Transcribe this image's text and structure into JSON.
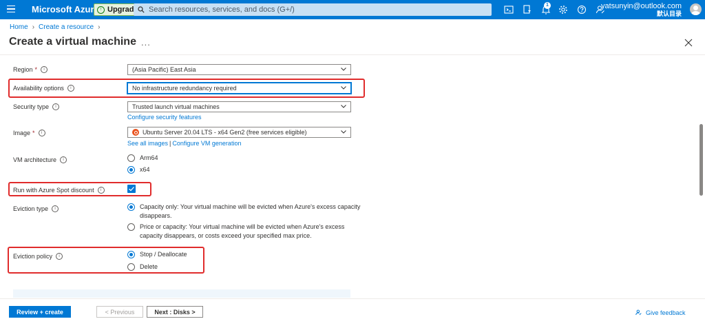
{
  "topbar": {
    "brand": "Microsoft Azure",
    "upgrade_label": "Upgrade",
    "search_placeholder": "Search resources, services, and docs (G+/)",
    "notification_count": "1",
    "account_email": "yatsunyin@outlook.com",
    "account_directory": "默认目录"
  },
  "breadcrumb": {
    "home": "Home",
    "create_resource": "Create a resource"
  },
  "page": {
    "title": "Create a virtual machine",
    "more": "..."
  },
  "form": {
    "region": {
      "label": "Region",
      "value": "(Asia Pacific) East Asia"
    },
    "availability": {
      "label": "Availability options",
      "value": "No infrastructure redundancy required"
    },
    "security_type": {
      "label": "Security type",
      "value": "Trusted launch virtual machines",
      "link": "Configure security features"
    },
    "image": {
      "label": "Image",
      "value": "Ubuntu Server 20.04 LTS - x64 Gen2 (free services eligible)",
      "link_all": "See all images",
      "link_sep": "|",
      "link_gen": "Configure VM generation"
    },
    "vm_architecture": {
      "label": "VM architecture",
      "options": [
        "Arm64",
        "x64"
      ],
      "selected": "x64"
    },
    "spot": {
      "label": "Run with Azure Spot discount",
      "checked": true
    },
    "eviction_type": {
      "label": "Eviction type",
      "options": [
        {
          "line1": "Capacity only: Your virtual machine will be evicted when Azure's excess capacity",
          "line2": "disappears."
        },
        {
          "line1": "Price or capacity: Your virtual machine will be evicted when Azure's excess",
          "line2": "capacity disappears, or costs exceed your specified max price."
        }
      ],
      "selected": 0
    },
    "eviction_policy": {
      "label": "Eviction policy",
      "options": [
        "Stop / Deallocate",
        "Delete"
      ],
      "selected": "Stop / Deallocate"
    }
  },
  "footer": {
    "review_create": "Review + create",
    "previous": "< Previous",
    "next": "Next : Disks >",
    "feedback": "Give feedback"
  },
  "colors": {
    "accent": "#0078d4",
    "highlight": "#e02b2b",
    "required": "#a4262c"
  }
}
